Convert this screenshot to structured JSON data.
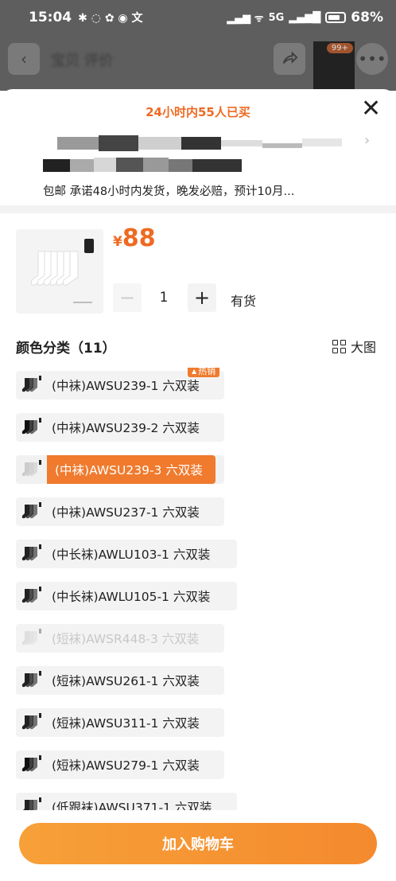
{
  "status_bar": {
    "time": "15:04",
    "battery": "68%",
    "signal": "5G"
  },
  "nav": {
    "title": "宝贝 评价",
    "cart_badge": "99+"
  },
  "sheet": {
    "bought_text": "24小时内55人已买",
    "shipping_text": "包邮 承诺48小时内发货，晚发必赔，预计10月...",
    "price_currency": "¥",
    "price_value": "88",
    "quantity": "1",
    "stock_status": "有货",
    "section_title": "颜色分类（11）",
    "big_image_label": "大图",
    "hot_badge": "热销",
    "options": [
      {
        "label": "(中袜)AWSU239-1 六双装",
        "state": "normal",
        "hot": true
      },
      {
        "label": "(中袜)AWSU239-2 六双装",
        "state": "normal"
      },
      {
        "label": "(中袜)AWSU239-3 六双装",
        "state": "selected"
      },
      {
        "label": "(中袜)AWSU237-1 六双装",
        "state": "normal"
      },
      {
        "label": "(中长袜)AWLU103-1 六双装",
        "state": "normal"
      },
      {
        "label": "(中长袜)AWLU105-1 六双装",
        "state": "normal"
      },
      {
        "label": "(短袜)AWSR448-3 六双装",
        "state": "disabled"
      },
      {
        "label": "(短袜)AWSU261-1 六双装",
        "state": "normal"
      },
      {
        "label": "(短袜)AWSU311-1 六双装",
        "state": "normal"
      },
      {
        "label": "(短袜)AWSU279-1 六双装",
        "state": "normal"
      },
      {
        "label": "(低跟袜)AWSU371-1 六双装",
        "state": "normal"
      }
    ],
    "cta_label": "加入购物车"
  },
  "colors": {
    "accent": "#f07a2d",
    "cta": "#f48a2e"
  }
}
